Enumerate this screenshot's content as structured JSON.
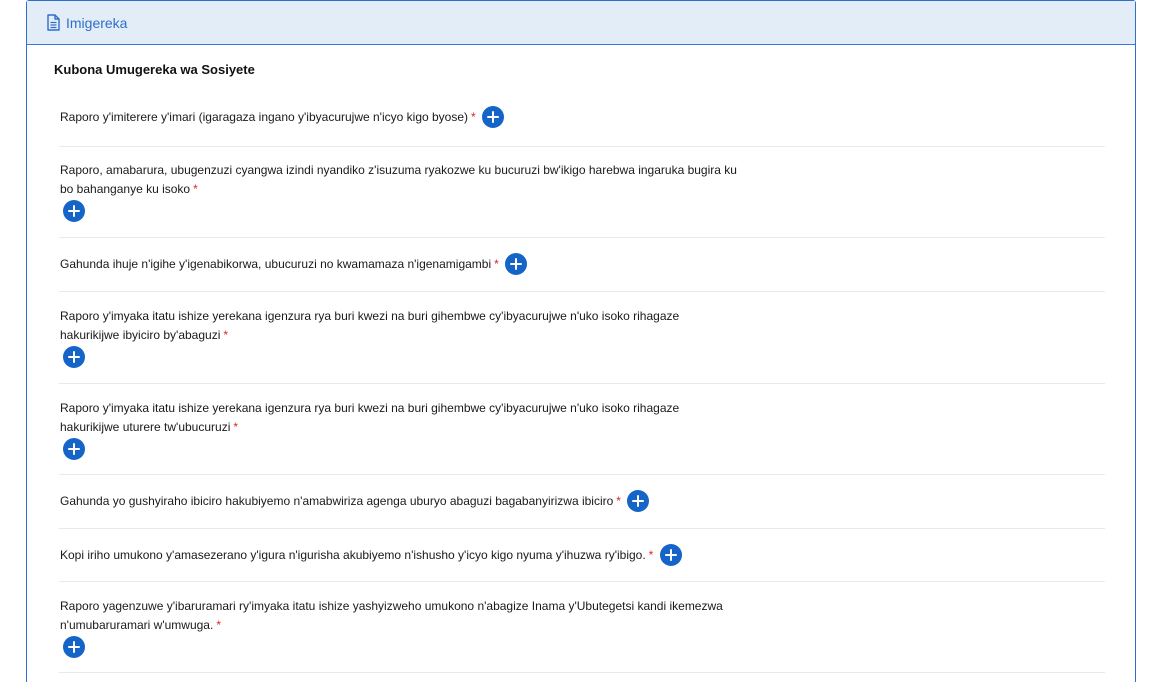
{
  "header": {
    "title": "Imigereka"
  },
  "section": {
    "title": "Kubona Umugereka wa Sosiyete"
  },
  "items": [
    {
      "label": "Raporo y'imiterere y'imari (igaragaza ingano y'ibyacurujwe n'icyo kigo byose)",
      "required": "*"
    },
    {
      "label": "Raporo, amabarura, ubugenzuzi cyangwa izindi nyandiko z'isuzuma ryakozwe ku bucuruzi bw'ikigo harebwa ingaruka bugira ku bo bahanganye ku isoko",
      "required": "*"
    },
    {
      "label": "Gahunda ihuje n'igihe y'igenabikorwa, ubucuruzi no kwamamaza n'igenamigambi",
      "required": "*"
    },
    {
      "label": "Raporo y'imyaka itatu ishize yerekana igenzura rya buri kwezi na buri gihembwe cy'ibyacurujwe n'uko isoko rihagaze hakurikijwe ibyiciro by'abaguzi",
      "required": "*"
    },
    {
      "label": "Raporo y'imyaka itatu ishize yerekana igenzura rya buri kwezi na buri gihembwe cy'ibyacurujwe n'uko isoko rihagaze hakurikijwe uturere tw'ubucuruzi",
      "required": "*"
    },
    {
      "label": "Gahunda yo gushyiraho ibiciro hakubiyemo n'amabwiriza agenga uburyo abaguzi bagabanyirizwa ibiciro",
      "required": "*"
    },
    {
      "label": "Kopi iriho umukono y'amasezerano y'igura n'igurisha akubiyemo n'ishusho y'icyo kigo nyuma y'ihuzwa ry'ibigo.",
      "required": "*"
    },
    {
      "label": "Raporo yagenzuwe y'ibaruramari ry'imyaka itatu ishize yashyizweho umukono n'abagize Inama y'Ubutegetsi kandi ikemezwa n'umubaruramari w'umwuga.",
      "required": "*"
    }
  ],
  "colors": {
    "accent": "#1565c9",
    "header_bg": "#e3edf8",
    "title_blue": "#2e6fc7",
    "required": "#e02424"
  },
  "icons": {
    "header": "document-icon",
    "add": "plus-circle-icon"
  }
}
